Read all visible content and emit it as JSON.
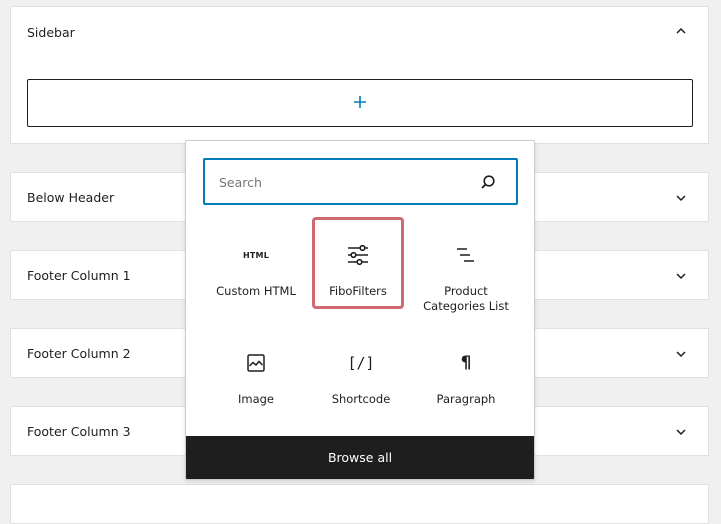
{
  "panels": {
    "sidebar": {
      "title": "Sidebar",
      "expanded": true,
      "chevron": "chevron-up-icon",
      "appender_icon": "plus-icon"
    },
    "below_header": {
      "title": "Below Header",
      "chevron": "chevron-down-icon"
    },
    "footer_column_1": {
      "title": "Footer Column 1",
      "chevron": "chevron-down-icon"
    },
    "footer_column_2": {
      "title": "Footer Column 2",
      "chevron": "chevron-down-icon"
    },
    "footer_column_3": {
      "title": "Footer Column 3",
      "chevron": "chevron-down-icon"
    }
  },
  "inserter": {
    "search": {
      "placeholder": "Search",
      "value": "",
      "icon": "search-icon"
    },
    "blocks": [
      {
        "label": "Custom HTML",
        "icon": "html-icon",
        "icon_text": "HTML"
      },
      {
        "label": "FiboFilters",
        "icon": "sliders-icon",
        "selected": true
      },
      {
        "label": "Product Categories List",
        "icon": "list-icon"
      },
      {
        "label": "Image",
        "icon": "image-icon"
      },
      {
        "label": "Shortcode",
        "icon": "shortcode-icon",
        "icon_text": "[/]"
      },
      {
        "label": "Paragraph",
        "icon": "paragraph-icon",
        "icon_text": "¶"
      }
    ],
    "browse_all_label": "Browse all"
  },
  "colors": {
    "accent": "#007cba",
    "highlight": "#cf6a72",
    "dark": "#1e1e1e",
    "background": "#f0f0f0"
  }
}
